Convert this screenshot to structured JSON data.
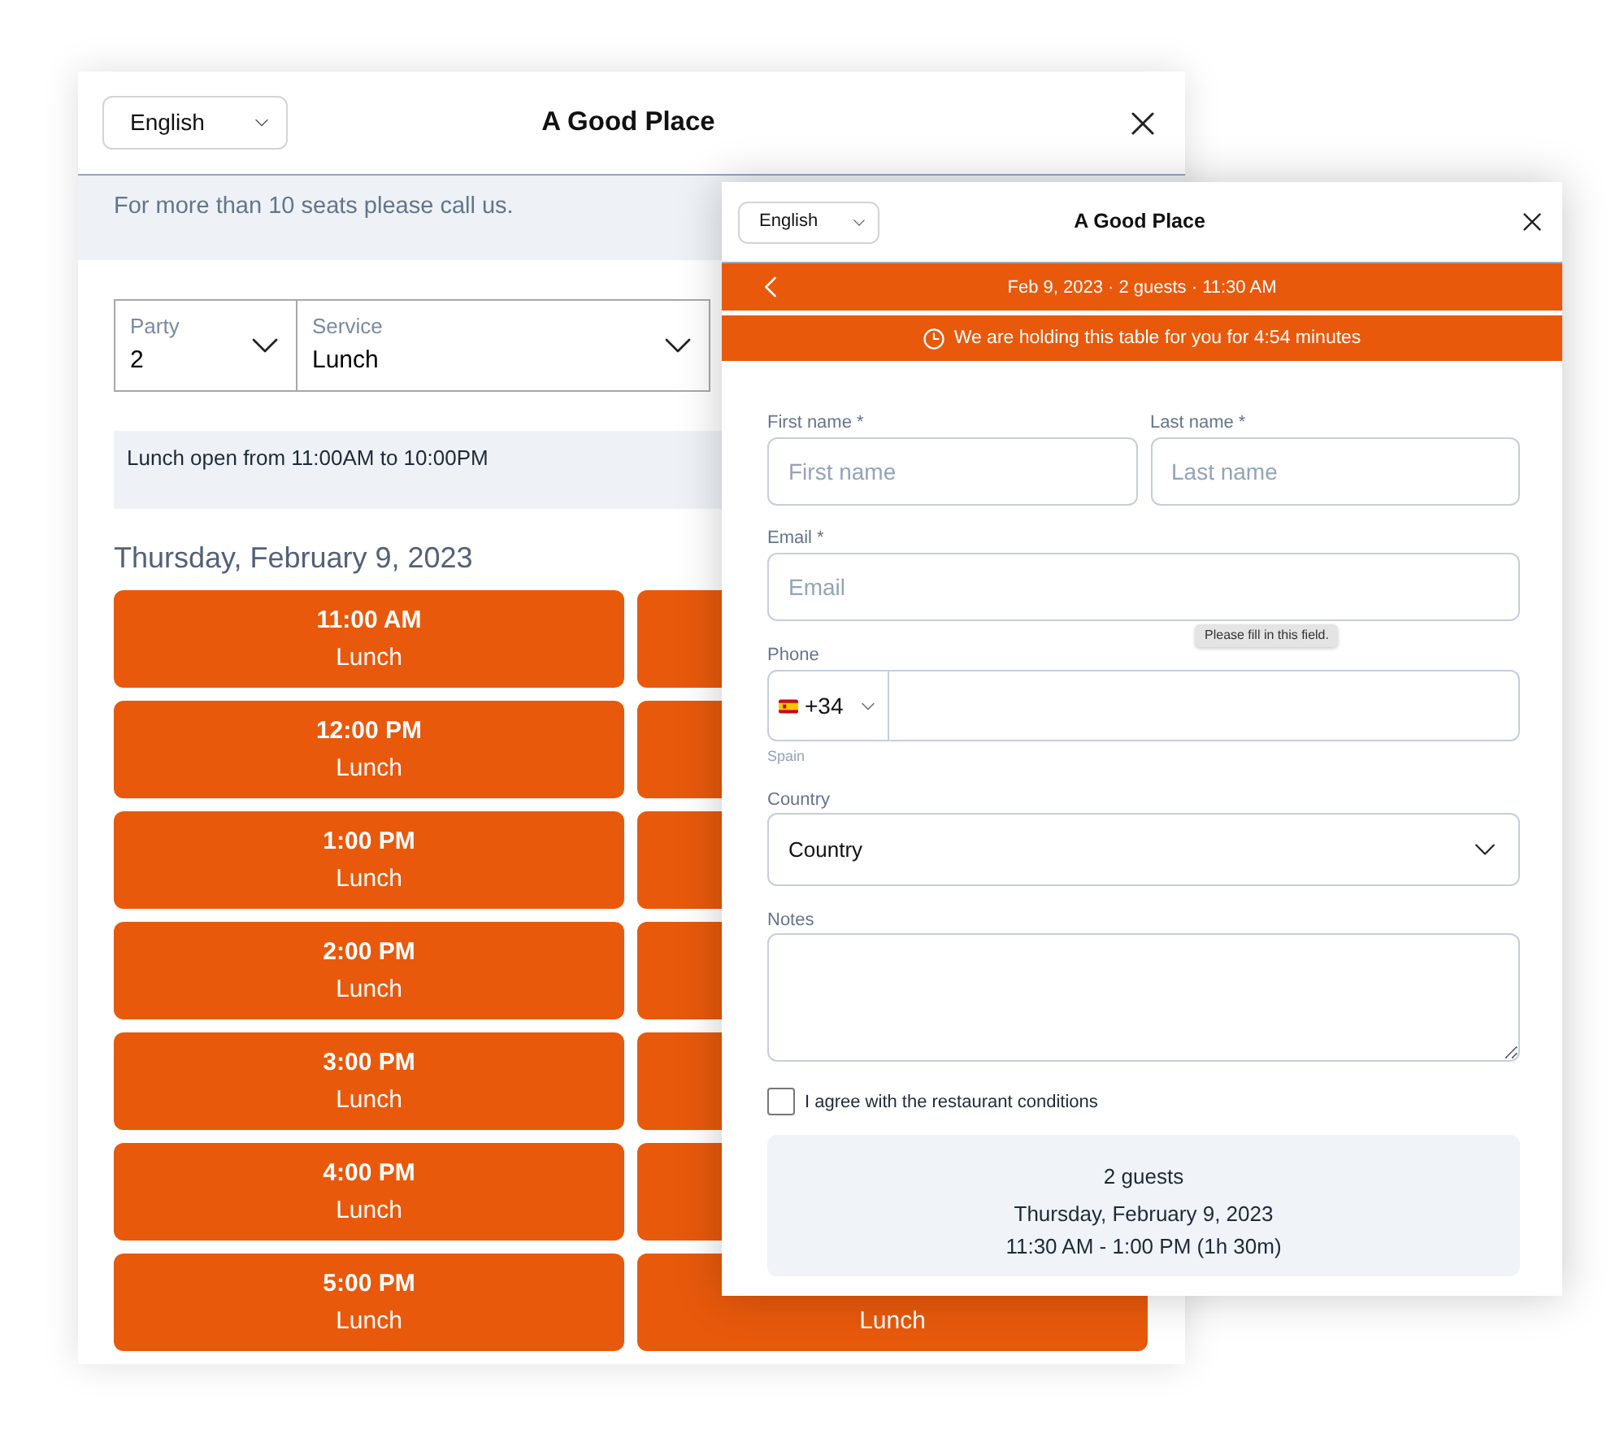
{
  "back_window": {
    "language": "English",
    "title": "A Good Place",
    "notice": "For more than 10 seats please call us.",
    "selectors": [
      {
        "label": "Party",
        "value": "2"
      },
      {
        "label": "Service",
        "value": "Lunch"
      }
    ],
    "service_hours": "Lunch open from 11:00AM to 10:00PM",
    "date_heading": "Thursday, February 9, 2023",
    "time_slots": [
      {
        "time": "11:00 AM",
        "service": "Lunch",
        "selected": false
      },
      {
        "selected": false
      },
      {
        "time": "12:00 PM",
        "service": "Lunch",
        "selected": false
      },
      {
        "selected": false
      },
      {
        "time": "1:00 PM",
        "service": "Lunch",
        "selected": false
      },
      {
        "selected": false
      },
      {
        "time": "2:00 PM",
        "service": "Lunch",
        "selected": false
      },
      {
        "selected": false
      },
      {
        "time": "3:00 PM",
        "service": "Lunch",
        "selected": false
      },
      {
        "selected": false
      },
      {
        "time": "4:00 PM",
        "service": "Lunch",
        "selected": false
      },
      {
        "selected": false
      },
      {
        "time": "5:00 PM",
        "service": "Lunch",
        "selected": false
      },
      {
        "service": "Lunch",
        "selected": false
      }
    ]
  },
  "front_window": {
    "language": "English",
    "title": "A Good Place",
    "booking_summary": "Feb 9, 2023 · 2 guests · 11:30 AM",
    "hold_notice": "We are holding this table for you for 4:54 minutes",
    "form": {
      "first_name": {
        "label": "First name *",
        "placeholder": "First name"
      },
      "last_name": {
        "label": "Last name *",
        "placeholder": "Last name"
      },
      "email": {
        "label": "Email *",
        "placeholder": "Email",
        "tooltip": "Please fill in this field."
      },
      "phone": {
        "label": "Phone",
        "country_code": "+34",
        "country_hint": "Spain"
      },
      "country": {
        "label": "Country",
        "value": "Country"
      },
      "notes": {
        "label": "Notes"
      },
      "agree": {
        "label": "I agree with the restaurant conditions",
        "checked": false
      }
    },
    "summary": [
      "2 guests",
      "Thursday, February 9, 2023",
      "11:30 AM - 1:00 PM (1h 30m)"
    ]
  }
}
